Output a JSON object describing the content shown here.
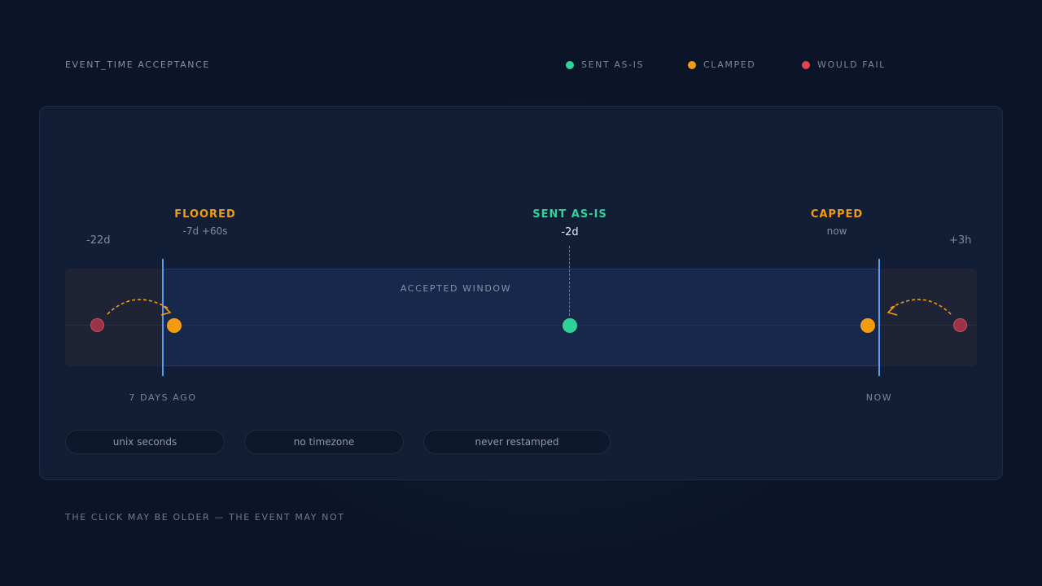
{
  "header": {
    "title": "EVENT_TIME ACCEPTANCE",
    "legend": [
      {
        "label": "SENT AS-IS",
        "color": "#2ed39a"
      },
      {
        "label": "CLAMPED",
        "color": "#f39c12"
      },
      {
        "label": "WOULD FAIL",
        "color": "#e04455"
      }
    ]
  },
  "timeline": {
    "edge_left_label": "-22d",
    "edge_right_label": "+3h",
    "window_label": "ACCEPTED WINDOW",
    "markers": {
      "floored": {
        "title": "FLOORED",
        "sub": "-7d +60s"
      },
      "sent": {
        "title": "SENT AS-IS",
        "sub": "-2d"
      },
      "capped": {
        "title": "CAPPED",
        "sub": "now"
      }
    },
    "bounds": {
      "left": "7 DAYS AGO",
      "right": "NOW"
    }
  },
  "pills": [
    "unix seconds",
    "no timezone",
    "never restamped"
  ],
  "footer": "THE CLICK MAY BE OLDER — THE EVENT MAY NOT",
  "colors": {
    "clamp": "#f39c12",
    "sent": "#2ed39a",
    "fail": "#e04455",
    "boundary": "#5a9cf0"
  }
}
